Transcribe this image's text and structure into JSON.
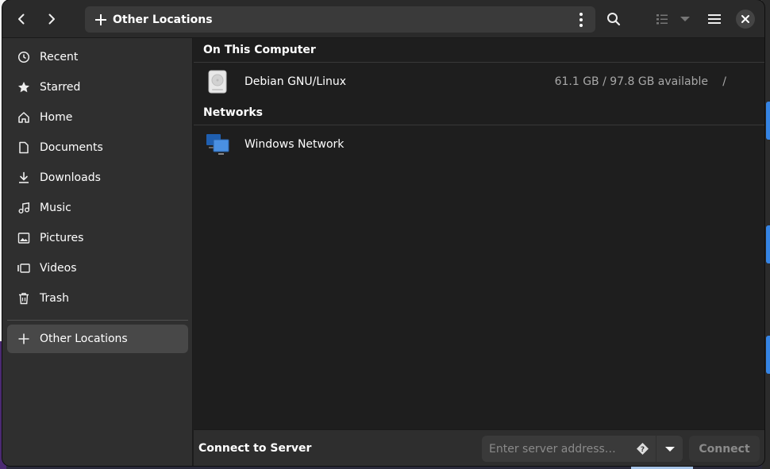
{
  "header": {
    "back_icon": "go-previous-icon",
    "forward_icon": "go-next-icon",
    "location": "Other Locations",
    "search_icon": "search-icon",
    "view_icon": "list-view-icon",
    "menu_icon": "hamburger-menu-icon",
    "close_icon": "close-icon"
  },
  "sidebar": {
    "items": [
      {
        "label": "Recent",
        "icon": "clock-icon"
      },
      {
        "label": "Starred",
        "icon": "star-icon"
      },
      {
        "label": "Home",
        "icon": "home-icon"
      },
      {
        "label": "Documents",
        "icon": "document-icon"
      },
      {
        "label": "Downloads",
        "icon": "download-icon"
      },
      {
        "label": "Music",
        "icon": "music-icon"
      },
      {
        "label": "Pictures",
        "icon": "picture-icon"
      },
      {
        "label": "Videos",
        "icon": "video-icon"
      },
      {
        "label": "Trash",
        "icon": "trash-icon"
      }
    ],
    "other_locations": {
      "label": "Other Locations",
      "icon": "plus-icon",
      "active": true
    }
  },
  "main": {
    "computer_heading": "On This Computer",
    "drive": {
      "name": "Debian GNU/Linux",
      "info": "61.1 GB / 97.8 GB available",
      "mount": "/",
      "icon": "hard-drive-icon"
    },
    "networks_heading": "Networks",
    "network": {
      "name": "Windows Network",
      "icon": "network-computers-icon"
    }
  },
  "actionbar": {
    "label": "Connect to Server",
    "placeholder": "Enter server address…",
    "connect_label": "Connect"
  },
  "colors": {
    "window_bg": "#1e1e1e",
    "sidebar_bg": "#2f2f2f",
    "header_bg": "#2a2a2a",
    "accent": "#3584e4"
  }
}
